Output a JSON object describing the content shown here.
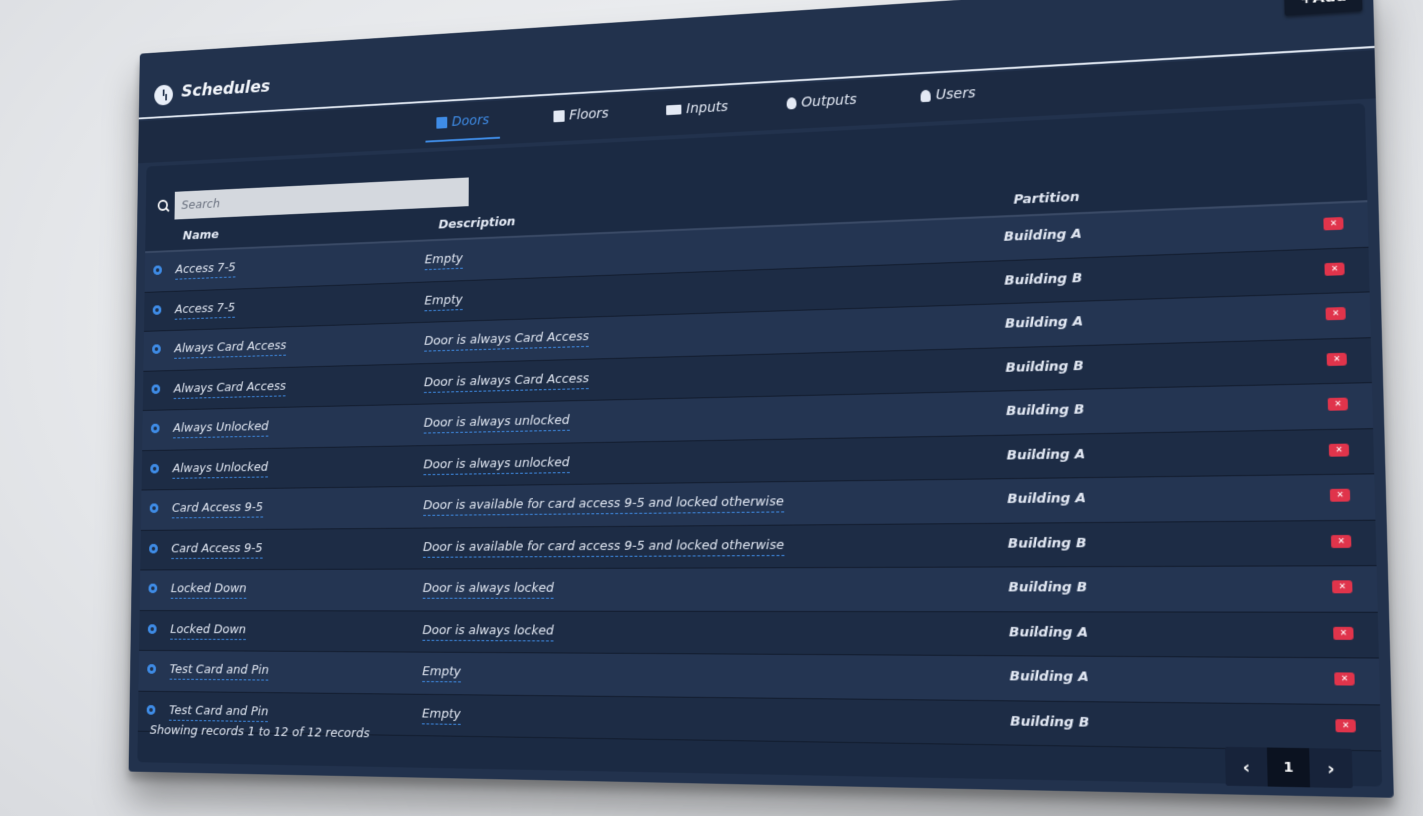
{
  "header": {
    "title": "Schedules",
    "add_label": "+Add"
  },
  "tabs": [
    {
      "label": "Doors",
      "icon": "door-icon",
      "active": true
    },
    {
      "label": "Floors",
      "icon": "building-icon",
      "active": false
    },
    {
      "label": "Inputs",
      "icon": "keyboard-icon",
      "active": false
    },
    {
      "label": "Outputs",
      "icon": "lightbulb-icon",
      "active": false
    },
    {
      "label": "Users",
      "icon": "user-icon",
      "active": false
    }
  ],
  "search": {
    "placeholder": "Search"
  },
  "table": {
    "columns": {
      "name": "Name",
      "description": "Description",
      "partition": "Partition"
    },
    "rows": [
      {
        "name": "Access 7-5",
        "description": "Empty",
        "partition": "Building A"
      },
      {
        "name": "Access 7-5",
        "description": "Empty",
        "partition": "Building B"
      },
      {
        "name": "Always Card Access",
        "description": "Door is always Card Access",
        "partition": "Building A"
      },
      {
        "name": "Always Card Access",
        "description": "Door is always Card Access",
        "partition": "Building B"
      },
      {
        "name": "Always Unlocked",
        "description": "Door is always unlocked",
        "partition": "Building B"
      },
      {
        "name": "Always Unlocked",
        "description": "Door is always unlocked",
        "partition": "Building A"
      },
      {
        "name": "Card Access 9-5",
        "description": "Door is available for card access 9-5 and locked otherwise",
        "partition": "Building A"
      },
      {
        "name": "Card Access 9-5",
        "description": "Door is available for card access 9-5 and locked otherwise",
        "partition": "Building B"
      },
      {
        "name": "Locked Down",
        "description": "Door is always locked",
        "partition": "Building B"
      },
      {
        "name": "Locked Down",
        "description": "Door is always locked",
        "partition": "Building A"
      },
      {
        "name": "Test Card and Pin",
        "description": "Empty",
        "partition": "Building A"
      },
      {
        "name": "Test Card and Pin",
        "description": "Empty",
        "partition": "Building B"
      }
    ]
  },
  "footer": {
    "records_text": "Showing records 1 to 12 of 12 records"
  },
  "pagination": {
    "prev": "‹",
    "page": "1",
    "next": "›"
  },
  "colors": {
    "accent": "#3f8ce6",
    "delete": "#e0344b",
    "panel": "#22324d"
  }
}
